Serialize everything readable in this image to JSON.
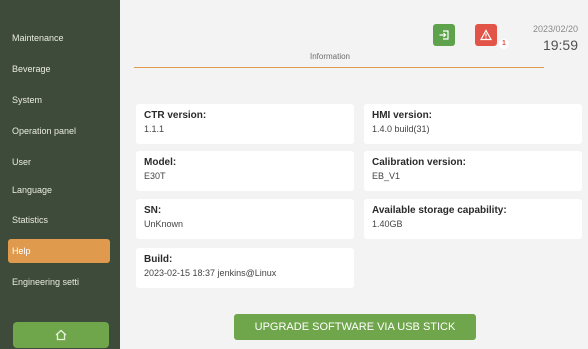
{
  "sidebar": {
    "items": [
      {
        "label": "Maintenance"
      },
      {
        "label": "Beverage"
      },
      {
        "label": "System"
      },
      {
        "label": "Operation panel"
      },
      {
        "label": "User"
      },
      {
        "label": "Language"
      },
      {
        "label": "Statistics"
      },
      {
        "label": "Help"
      },
      {
        "label": "Engineering setti"
      }
    ],
    "active_index": 7,
    "home_icon": "home-icon"
  },
  "header": {
    "date": "2023/02/20",
    "time": "19:59",
    "alarm_count": "1",
    "logout_icon": "logout-icon",
    "alarm_icon": "warning-icon"
  },
  "section": {
    "title": "Information"
  },
  "info": {
    "ctr_version": {
      "label": "CTR version:",
      "value": "1.1.1"
    },
    "hmi_version": {
      "label": "HMI version:",
      "value": "1.4.0 build(31)"
    },
    "model": {
      "label": "Model:",
      "value": "E30T"
    },
    "calibration_version": {
      "label": "Calibration version:",
      "value": "EB_V1"
    },
    "sn": {
      "label": "SN:",
      "value": "UnKnown"
    },
    "storage": {
      "label": "Available storage capability:",
      "value": "1.40GB"
    },
    "build": {
      "label": "Build:",
      "value": "2023-02-15 18:37 jenkins@Linux"
    }
  },
  "actions": {
    "upgrade_label": "UPGRADE SOFTWARE VIA USB STICK"
  },
  "colors": {
    "sidebar_bg": "#3f4b3a",
    "accent": "#e09a4e",
    "green": "#6fa64b",
    "alarm": "#e25448"
  }
}
